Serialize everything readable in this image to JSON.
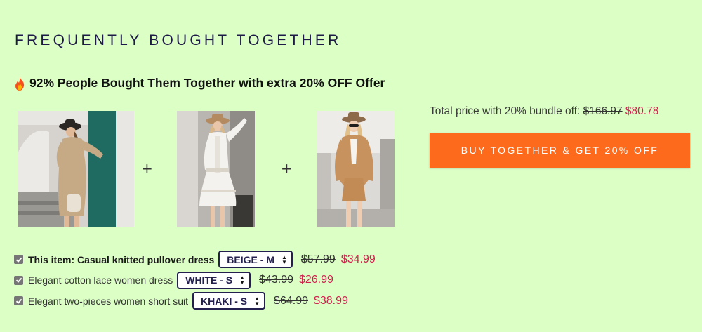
{
  "section": {
    "title": "FREQUENTLY BOUGHT TOGETHER",
    "offer_text": "92% People Bought Them Together with extra 20% OFF Offer"
  },
  "products": [
    {
      "image": "knitted-pullover-dress-photo",
      "colors": {
        "bg": "#c9c4bc",
        "dress": "#c6aa86",
        "wall": "#1f6b62"
      }
    },
    {
      "image": "cotton-lace-dress-photo",
      "colors": {
        "bg": "#b7b2ab",
        "dress": "#f3f1ee"
      }
    },
    {
      "image": "two-piece-short-suit-photo",
      "colors": {
        "bg": "#d8d6d2",
        "suit": "#c7925e"
      }
    }
  ],
  "plus_sign": "+",
  "summary": {
    "label": "Total price with 20% bundle off:",
    "old_total": "$166.97",
    "new_total": "$80.78",
    "button_label": "BUY TOGETHER & GET 20% OFF"
  },
  "items": [
    {
      "name": "This item: Casual knitted pullover dress",
      "option": "BEIGE - M",
      "old_price": "$57.99",
      "new_price": "$34.99"
    },
    {
      "name": "Elegant cotton lace women dress",
      "option": "WHITE - S",
      "old_price": "$43.99",
      "new_price": "$26.99"
    },
    {
      "name": "Elegant two-pieces women short suit",
      "option": "KHAKI - S",
      "old_price": "$64.99",
      "new_price": "$38.99"
    }
  ],
  "colors": {
    "background": "#dcffc6",
    "button": "#fe6a1c",
    "sale_price": "#d21f4e",
    "title": "#1d1a47"
  }
}
